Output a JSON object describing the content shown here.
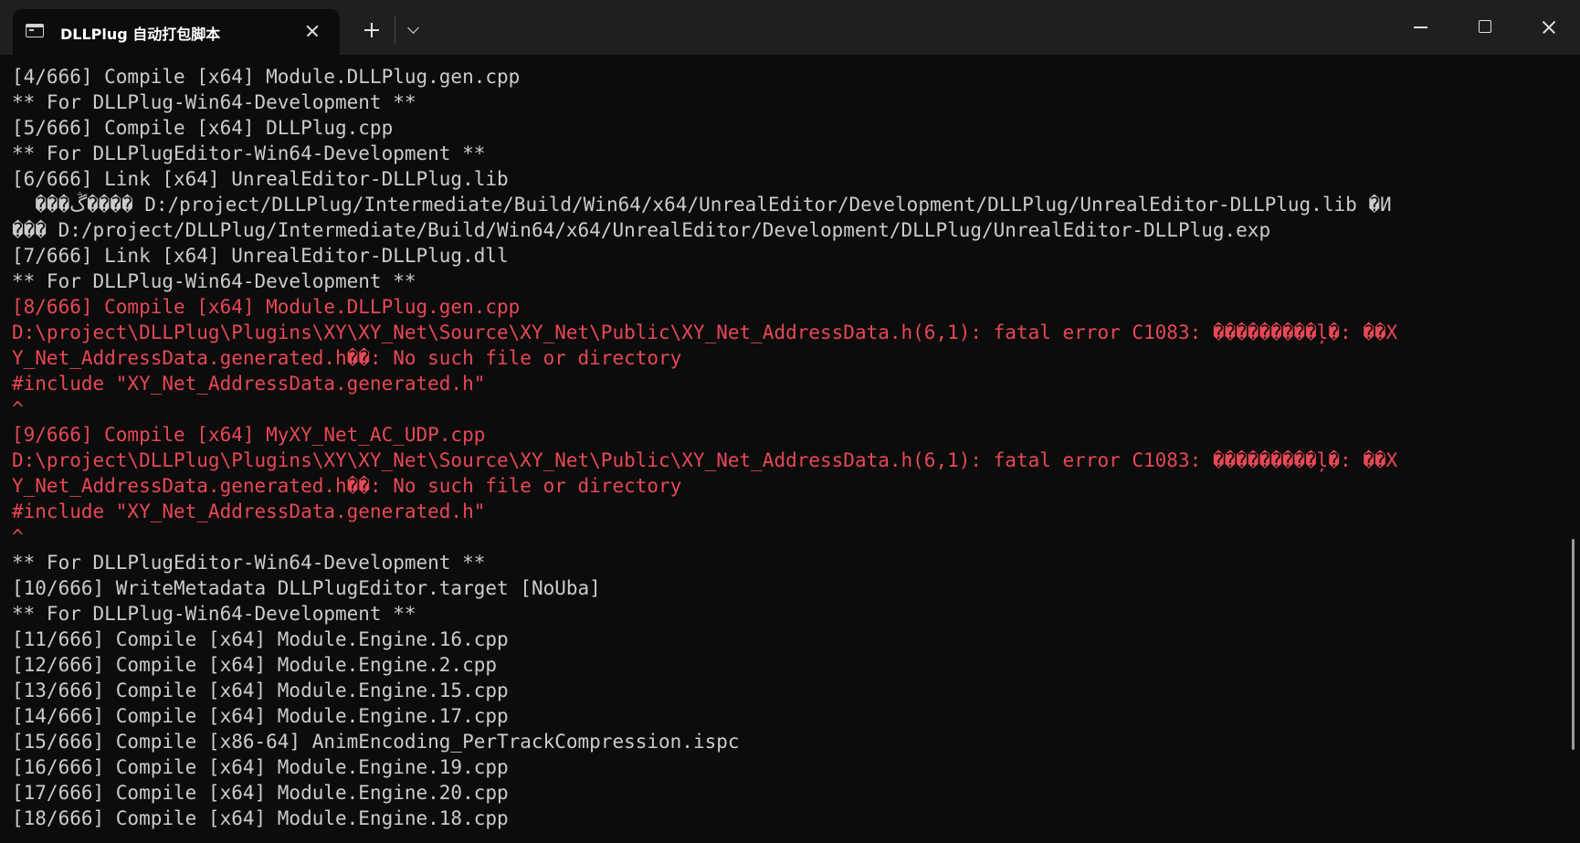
{
  "window": {
    "tab_title": "DLLPlug 自动打包脚本"
  },
  "console": {
    "lines": [
      {
        "text": "[4/666] Compile [x64] Module.DLLPlug.gen.cpp",
        "error": false
      },
      {
        "text": "** For DLLPlug-Win64-Development **",
        "error": false
      },
      {
        "text": "[5/666] Compile [x64] DLLPlug.cpp",
        "error": false
      },
      {
        "text": "** For DLLPlugEditor-Win64-Development **",
        "error": false
      },
      {
        "text": "[6/666] Link [x64] UnrealEditor-DLLPlug.lib",
        "error": false
      },
      {
        "text": "  ���ڴ���� D:/project/DLLPlug/Intermediate/Build/Win64/x64/UnrealEditor/Development/DLLPlug/UnrealEditor-DLLPlug.lib �И",
        "error": false
      },
      {
        "text": "��� D:/project/DLLPlug/Intermediate/Build/Win64/x64/UnrealEditor/Development/DLLPlug/UnrealEditor-DLLPlug.exp",
        "error": false
      },
      {
        "text": "[7/666] Link [x64] UnrealEditor-DLLPlug.dll",
        "error": false
      },
      {
        "text": "** For DLLPlug-Win64-Development **",
        "error": false
      },
      {
        "text": "[8/666] Compile [x64] Module.DLLPlug.gen.cpp",
        "error": true
      },
      {
        "text": "D:\\project\\DLLPlug\\Plugins\\XY\\XY_Net\\Source\\XY_Net\\Public\\XY_Net_AddressData.h(6,1): fatal error C1083: ���������ļ�: ��X",
        "error": true
      },
      {
        "text": "Y_Net_AddressData.generated.h��: No such file or directory",
        "error": true
      },
      {
        "text": "#include \"XY_Net_AddressData.generated.h\"",
        "error": true
      },
      {
        "text": "^",
        "error": true
      },
      {
        "text": "[9/666] Compile [x64] MyXY_Net_AC_UDP.cpp",
        "error": true
      },
      {
        "text": "D:\\project\\DLLPlug\\Plugins\\XY\\XY_Net\\Source\\XY_Net\\Public\\XY_Net_AddressData.h(6,1): fatal error C1083: ���������ļ�: ��X",
        "error": true
      },
      {
        "text": "Y_Net_AddressData.generated.h��: No such file or directory",
        "error": true
      },
      {
        "text": "#include \"XY_Net_AddressData.generated.h\"",
        "error": true
      },
      {
        "text": "^",
        "error": true
      },
      {
        "text": "** For DLLPlugEditor-Win64-Development **",
        "error": false
      },
      {
        "text": "[10/666] WriteMetadata DLLPlugEditor.target [NoUba]",
        "error": false
      },
      {
        "text": "** For DLLPlug-Win64-Development **",
        "error": false
      },
      {
        "text": "[11/666] Compile [x64] Module.Engine.16.cpp",
        "error": false
      },
      {
        "text": "[12/666] Compile [x64] Module.Engine.2.cpp",
        "error": false
      },
      {
        "text": "[13/666] Compile [x64] Module.Engine.15.cpp",
        "error": false
      },
      {
        "text": "[14/666] Compile [x64] Module.Engine.17.cpp",
        "error": false
      },
      {
        "text": "[15/666] Compile [x86-64] AnimEncoding_PerTrackCompression.ispc",
        "error": false
      },
      {
        "text": "[16/666] Compile [x64] Module.Engine.19.cpp",
        "error": false
      },
      {
        "text": "[17/666] Compile [x64] Module.Engine.20.cpp",
        "error": false
      },
      {
        "text": "[18/666] Compile [x64] Module.Engine.18.cpp",
        "error": false
      }
    ]
  },
  "colors": {
    "background": "#0c0c0c",
    "titlebar": "#1f1f1f",
    "text": "#cccccc",
    "error_text": "#e74856"
  },
  "icons": {
    "tab": "terminal-icon",
    "new_tab": "plus-icon",
    "dropdown": "chevron-down-icon",
    "minimize": "minimize-icon",
    "maximize": "maximize-icon",
    "close": "close-icon"
  }
}
